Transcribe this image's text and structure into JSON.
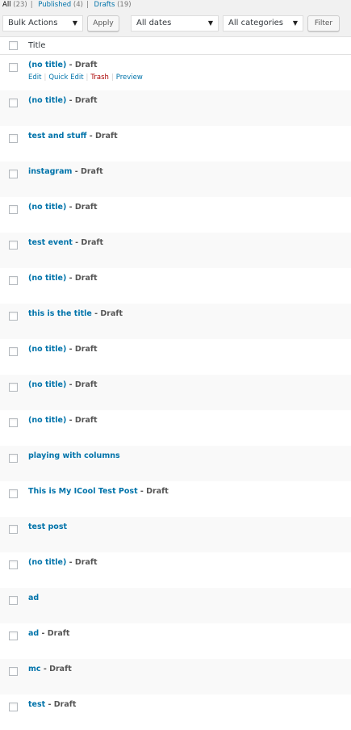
{
  "filters": {
    "all_label": "All",
    "all_count": "(23)",
    "published_label": "Published",
    "published_count": "(4)",
    "drafts_label": "Drafts",
    "drafts_count": "(19)",
    "separator": "|"
  },
  "toolbar": {
    "bulk_actions": "Bulk Actions",
    "apply_label": "Apply",
    "dates": "All dates",
    "categories": "All categories",
    "filter_label": "Filter",
    "dropdown_arrow": "▼"
  },
  "table": {
    "column_title": "Title",
    "row_actions": {
      "edit": "Edit",
      "quick_edit": "Quick Edit",
      "trash": "Trash",
      "preview": "Preview",
      "separator": "|"
    },
    "rows": [
      {
        "title": "(no title)",
        "state": " - Draft"
      },
      {
        "title": "(no title)",
        "state": " - Draft"
      },
      {
        "title": "test and stuff",
        "state": " - Draft"
      },
      {
        "title": "instagram",
        "state": " - Draft"
      },
      {
        "title": "(no title)",
        "state": " - Draft"
      },
      {
        "title": "test event",
        "state": " - Draft"
      },
      {
        "title": "(no title)",
        "state": " - Draft"
      },
      {
        "title": "this is the title",
        "state": " - Draft"
      },
      {
        "title": "(no title)",
        "state": " - Draft"
      },
      {
        "title": "(no title)",
        "state": " - Draft"
      },
      {
        "title": "(no title)",
        "state": " - Draft"
      },
      {
        "title": "playing with columns",
        "state": ""
      },
      {
        "title": "This is My ICool Test Post",
        "state": " - Draft"
      },
      {
        "title": "test post",
        "state": ""
      },
      {
        "title": "(no title)",
        "state": " - Draft"
      },
      {
        "title": "ad",
        "state": ""
      },
      {
        "title": "ad",
        "state": " - Draft"
      },
      {
        "title": "mc",
        "state": " - Draft"
      },
      {
        "title": "test",
        "state": " - Draft"
      }
    ]
  }
}
